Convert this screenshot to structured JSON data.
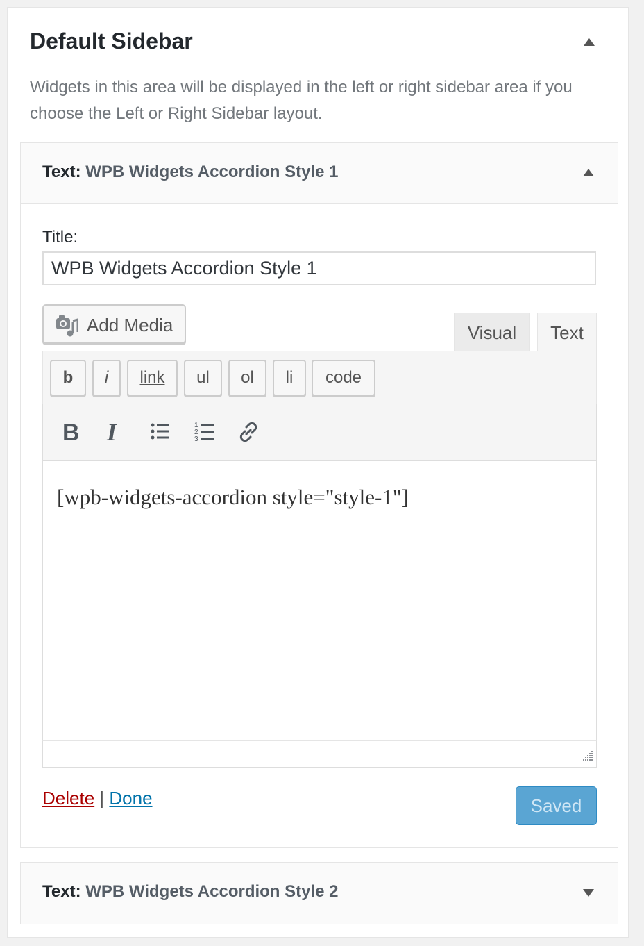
{
  "sidebar": {
    "title": "Default Sidebar",
    "description": "Widgets in this area will be displayed in the left or right sidebar area if you choose the Left or Right Sidebar layout."
  },
  "widget1": {
    "type_label": "Text:",
    "name": "WPB Widgets Accordion Style 1",
    "title_label": "Title:",
    "title_value": "WPB Widgets Accordion Style 1",
    "add_media_label": "Add Media",
    "tabs": {
      "visual": "Visual",
      "text": "Text"
    },
    "quicktags": [
      "b",
      "i",
      "link",
      "ul",
      "ol",
      "li",
      "code"
    ],
    "format_icons": [
      "bold-icon",
      "italic-icon",
      "bulleted-list-icon",
      "numbered-list-icon",
      "link-icon"
    ],
    "editor_content": "[wpb-widgets-accordion style=\"style-1\"]",
    "delete_label": "Delete",
    "separator": "|",
    "done_label": "Done",
    "saved_label": "Saved"
  },
  "widget2": {
    "type_label": "Text:",
    "name": "WPB Widgets Accordion Style 2"
  },
  "colors": {
    "delete": "#aa0000",
    "done": "#0073aa",
    "saved_bg": "#5aa5d3"
  }
}
